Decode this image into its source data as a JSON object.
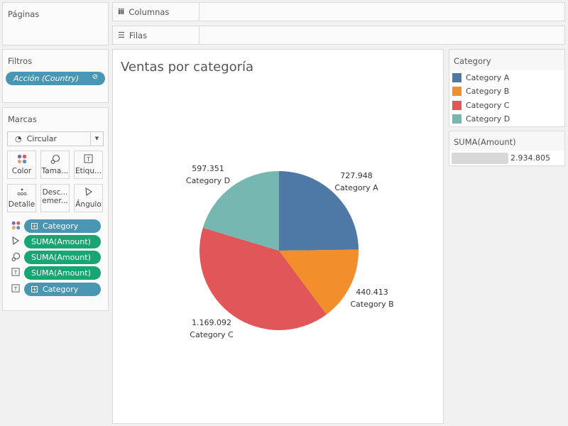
{
  "pages": {
    "title": "Páginas"
  },
  "shelves": {
    "columns": {
      "label": "Columnas",
      "icon": "columns-icon"
    },
    "rows": {
      "label": "Filas",
      "icon": "rows-icon"
    }
  },
  "filters": {
    "title": "Filtros",
    "pills": [
      {
        "label": "Acción (Country)",
        "icon": "linked-filter-icon"
      }
    ]
  },
  "marks": {
    "title": "Marcas",
    "mark_type": "Circular",
    "buttons": [
      {
        "label": "Color",
        "icon": "color-icon"
      },
      {
        "label": "Tama...",
        "icon": "size-icon"
      },
      {
        "label": "Etiqu...",
        "icon": "label-icon"
      },
      {
        "label": "Detalle",
        "icon": "detail-icon"
      },
      {
        "label": "Desc... emer...",
        "icon": "tooltip-icon"
      },
      {
        "label": "Ángulo",
        "icon": "angle-icon"
      }
    ],
    "fields": [
      {
        "label": "Category",
        "type": "dimension",
        "encoding": "color"
      },
      {
        "label": "SUMA(Amount)",
        "type": "measure",
        "encoding": "angle"
      },
      {
        "label": "SUMA(Amount)",
        "type": "measure",
        "encoding": "size"
      },
      {
        "label": "SUMA(Amount)",
        "type": "measure",
        "encoding": "label"
      },
      {
        "label": "Category",
        "type": "dimension",
        "encoding": "label"
      }
    ]
  },
  "view": {
    "title": "Ventas por categoría"
  },
  "legend": {
    "title": "Category",
    "items": [
      {
        "label": "Category A",
        "color": "#4e79a7"
      },
      {
        "label": "Category B",
        "color": "#f28e2b"
      },
      {
        "label": "Category C",
        "color": "#e15759"
      },
      {
        "label": "Category D",
        "color": "#76b7b2"
      }
    ]
  },
  "size_legend": {
    "title": "SUMA(Amount)",
    "value": "2.934.805"
  },
  "chart_data": {
    "type": "pie",
    "title": "Ventas por categoría",
    "categories": [
      "Category A",
      "Category B",
      "Category C",
      "Category D"
    ],
    "values": [
      727948,
      440413,
      1169092,
      597351
    ],
    "value_labels": [
      "727.948",
      "440.413",
      "1.169.092",
      "597.351"
    ],
    "colors": [
      "#4e79a7",
      "#f28e2b",
      "#e15759",
      "#76b7b2"
    ],
    "total": 2934805,
    "start_angle": "12 o'clock",
    "direction": "clockwise",
    "legend": "right"
  }
}
